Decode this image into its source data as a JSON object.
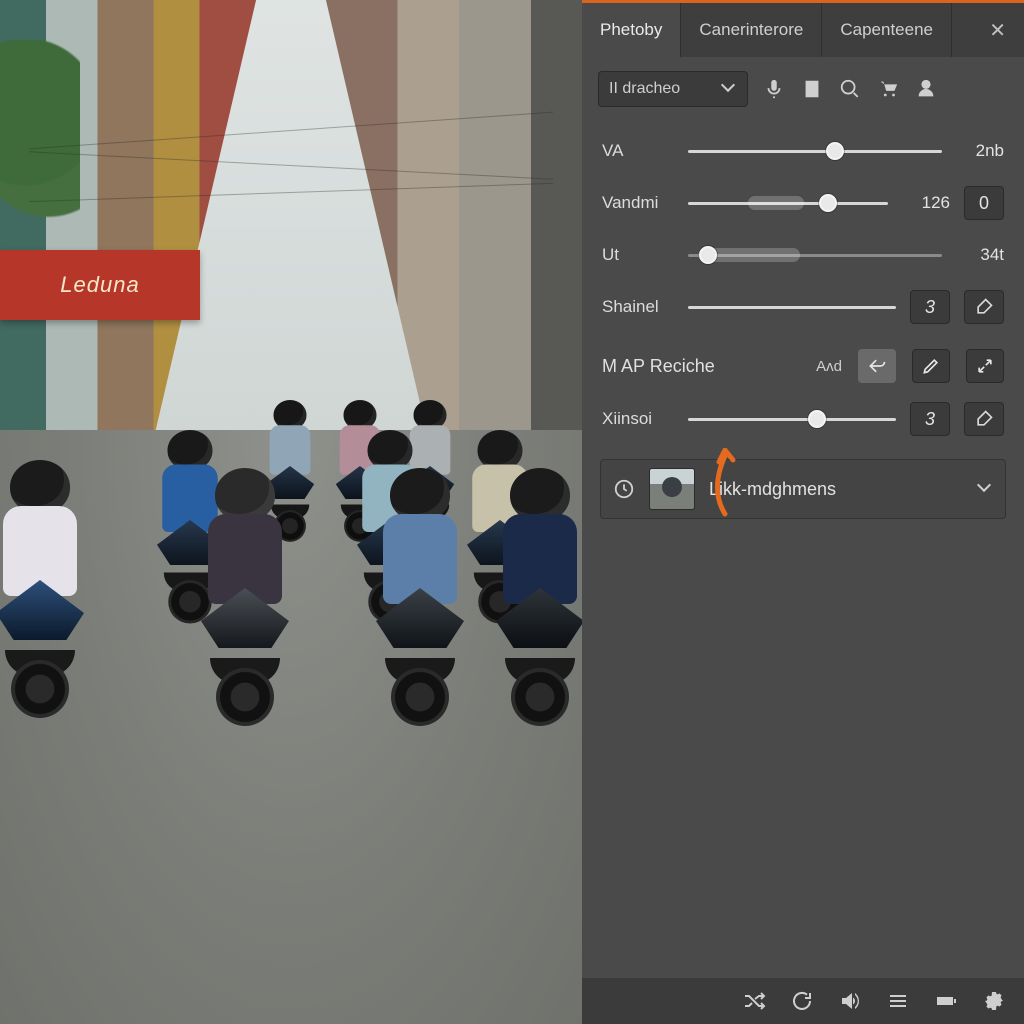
{
  "tabs": [
    {
      "label": "Phetoby",
      "active": true
    },
    {
      "label": "Canerinterore",
      "active": false
    },
    {
      "label": "Capenteene",
      "active": false
    }
  ],
  "close_glyph": "✕",
  "dropdown": {
    "label": "II dracheo"
  },
  "toolbar_icons": [
    "mic-icon",
    "notes-icon",
    "search-icon",
    "cart-icon",
    "profile-icon"
  ],
  "sliders": {
    "va": {
      "label": "VA",
      "value_text": "2nb",
      "pct": 58
    },
    "vandmi": {
      "label": "Vandmi",
      "value_text": "126",
      "aux": "0",
      "pct": 70,
      "glow_start": 30,
      "glow_end": 58
    },
    "ut": {
      "label": "Ut",
      "value_text": "34t",
      "pct": 8,
      "glow_start": 6,
      "glow_end": 42
    },
    "shainel": {
      "label": "Shainel",
      "box": "3",
      "pct": 0,
      "has_brush": true
    },
    "xiinsoi": {
      "label": "Xiinsoi",
      "box": "3",
      "pct": 62,
      "has_brush": true
    }
  },
  "section": {
    "title": "M AP Reciche",
    "tag": "Aʌd"
  },
  "layer": {
    "label": "Likk-mdghmens"
  },
  "canvas": {
    "sign_text": "Leduna"
  },
  "status_icons": [
    "shuffle-icon",
    "refresh-icon",
    "volume-icon",
    "list-icon",
    "battery-icon",
    "gear-icon"
  ]
}
